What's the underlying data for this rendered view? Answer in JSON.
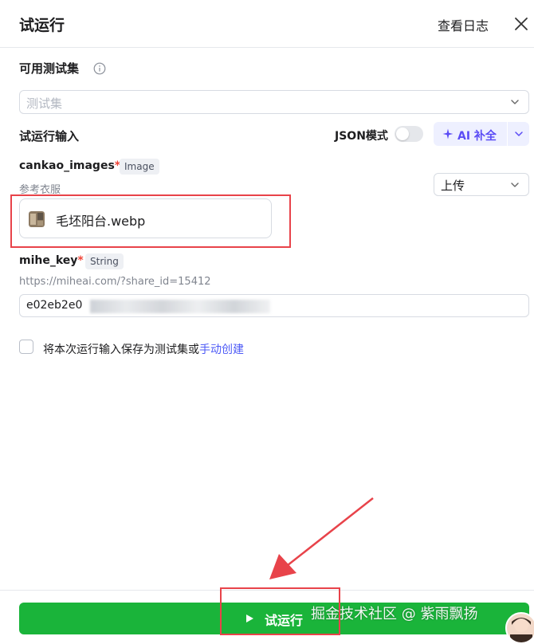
{
  "header": {
    "title": "试运行",
    "view_log": "查看日志"
  },
  "test_set": {
    "label": "可用测试集",
    "placeholder": "测试集"
  },
  "run_input": {
    "label": "试运行输入",
    "json_mode_label": "JSON模式",
    "json_mode_on": false,
    "ai_fill_label": "AI 补全"
  },
  "fields": {
    "cankao_images": {
      "name": "cankao_images",
      "required_mark": "*",
      "type": "Image",
      "description": "参考衣服",
      "upload_label": "上传",
      "file_name": "毛坯阳台.webp"
    },
    "mihe_key": {
      "name": "mihe_key",
      "required_mark": "*",
      "type": "String",
      "description": "https://miheai.com/?share_id=15412",
      "value": "e02eb2e0"
    }
  },
  "save_option": {
    "text": "将本次运行输入保存为测试集或",
    "link": "手动创建",
    "checked": false
  },
  "footer": {
    "run_label": "试运行"
  },
  "watermark": "掘金技术社区 @ 紫雨飘扬",
  "colors": {
    "run_button": "#1ab43a",
    "accent": "#5b4cf5",
    "link": "#4e5bf6",
    "required": "#f04438",
    "annotation": "#e8434a"
  }
}
